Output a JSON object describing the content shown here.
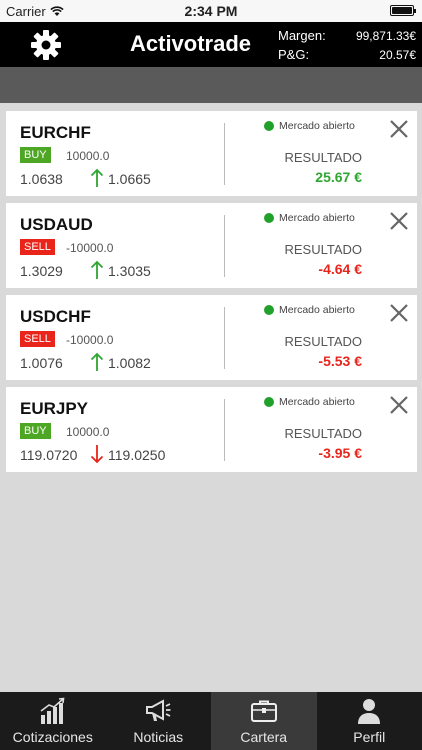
{
  "status_bar": {
    "carrier": "Carrier",
    "time": "2:34 PM"
  },
  "header": {
    "title": "Activotrade",
    "margin_label": "Margen:",
    "margin_value": "99,871.33€",
    "pl_label": "P&G:",
    "pl_value": "20.57€"
  },
  "positions": [
    {
      "pair": "EURCHF",
      "side": "BUY",
      "amount": "10000.0",
      "open": "1.0638",
      "current": "1.0665",
      "direction": "up",
      "status": "Mercado abierto",
      "result_label": "RESULTADO",
      "result": "25.67 €",
      "result_sign": "pos"
    },
    {
      "pair": "USDAUD",
      "side": "SELL",
      "amount": "-10000.0",
      "open": "1.3029",
      "current": "1.3035",
      "direction": "up",
      "status": "Mercado abierto",
      "result_label": "RESULTADO",
      "result": "-4.64 €",
      "result_sign": "neg"
    },
    {
      "pair": "USDCHF",
      "side": "SELL",
      "amount": "-10000.0",
      "open": "1.0076",
      "current": "1.0082",
      "direction": "up",
      "status": "Mercado abierto",
      "result_label": "RESULTADO",
      "result": "-5.53 €",
      "result_sign": "neg"
    },
    {
      "pair": "EURJPY",
      "side": "BUY",
      "amount": "10000.0",
      "open": "119.0720",
      "current": "119.0250",
      "direction": "down",
      "status": "Mercado abierto",
      "result_label": "RESULTADO",
      "result": "-3.95 €",
      "result_sign": "neg"
    }
  ],
  "tabs": [
    {
      "label": "Cotizaciones",
      "icon": "chart-icon",
      "active": false
    },
    {
      "label": "Noticias",
      "icon": "megaphone-icon",
      "active": false
    },
    {
      "label": "Cartera",
      "icon": "briefcase-icon",
      "active": true
    },
    {
      "label": "Perfil",
      "icon": "person-icon",
      "active": false
    }
  ],
  "colors": {
    "buy": "#4ea625",
    "sell": "#e8241b",
    "positive": "#2fa630",
    "negative": "#e8241b",
    "market_open": "#21a12b"
  }
}
